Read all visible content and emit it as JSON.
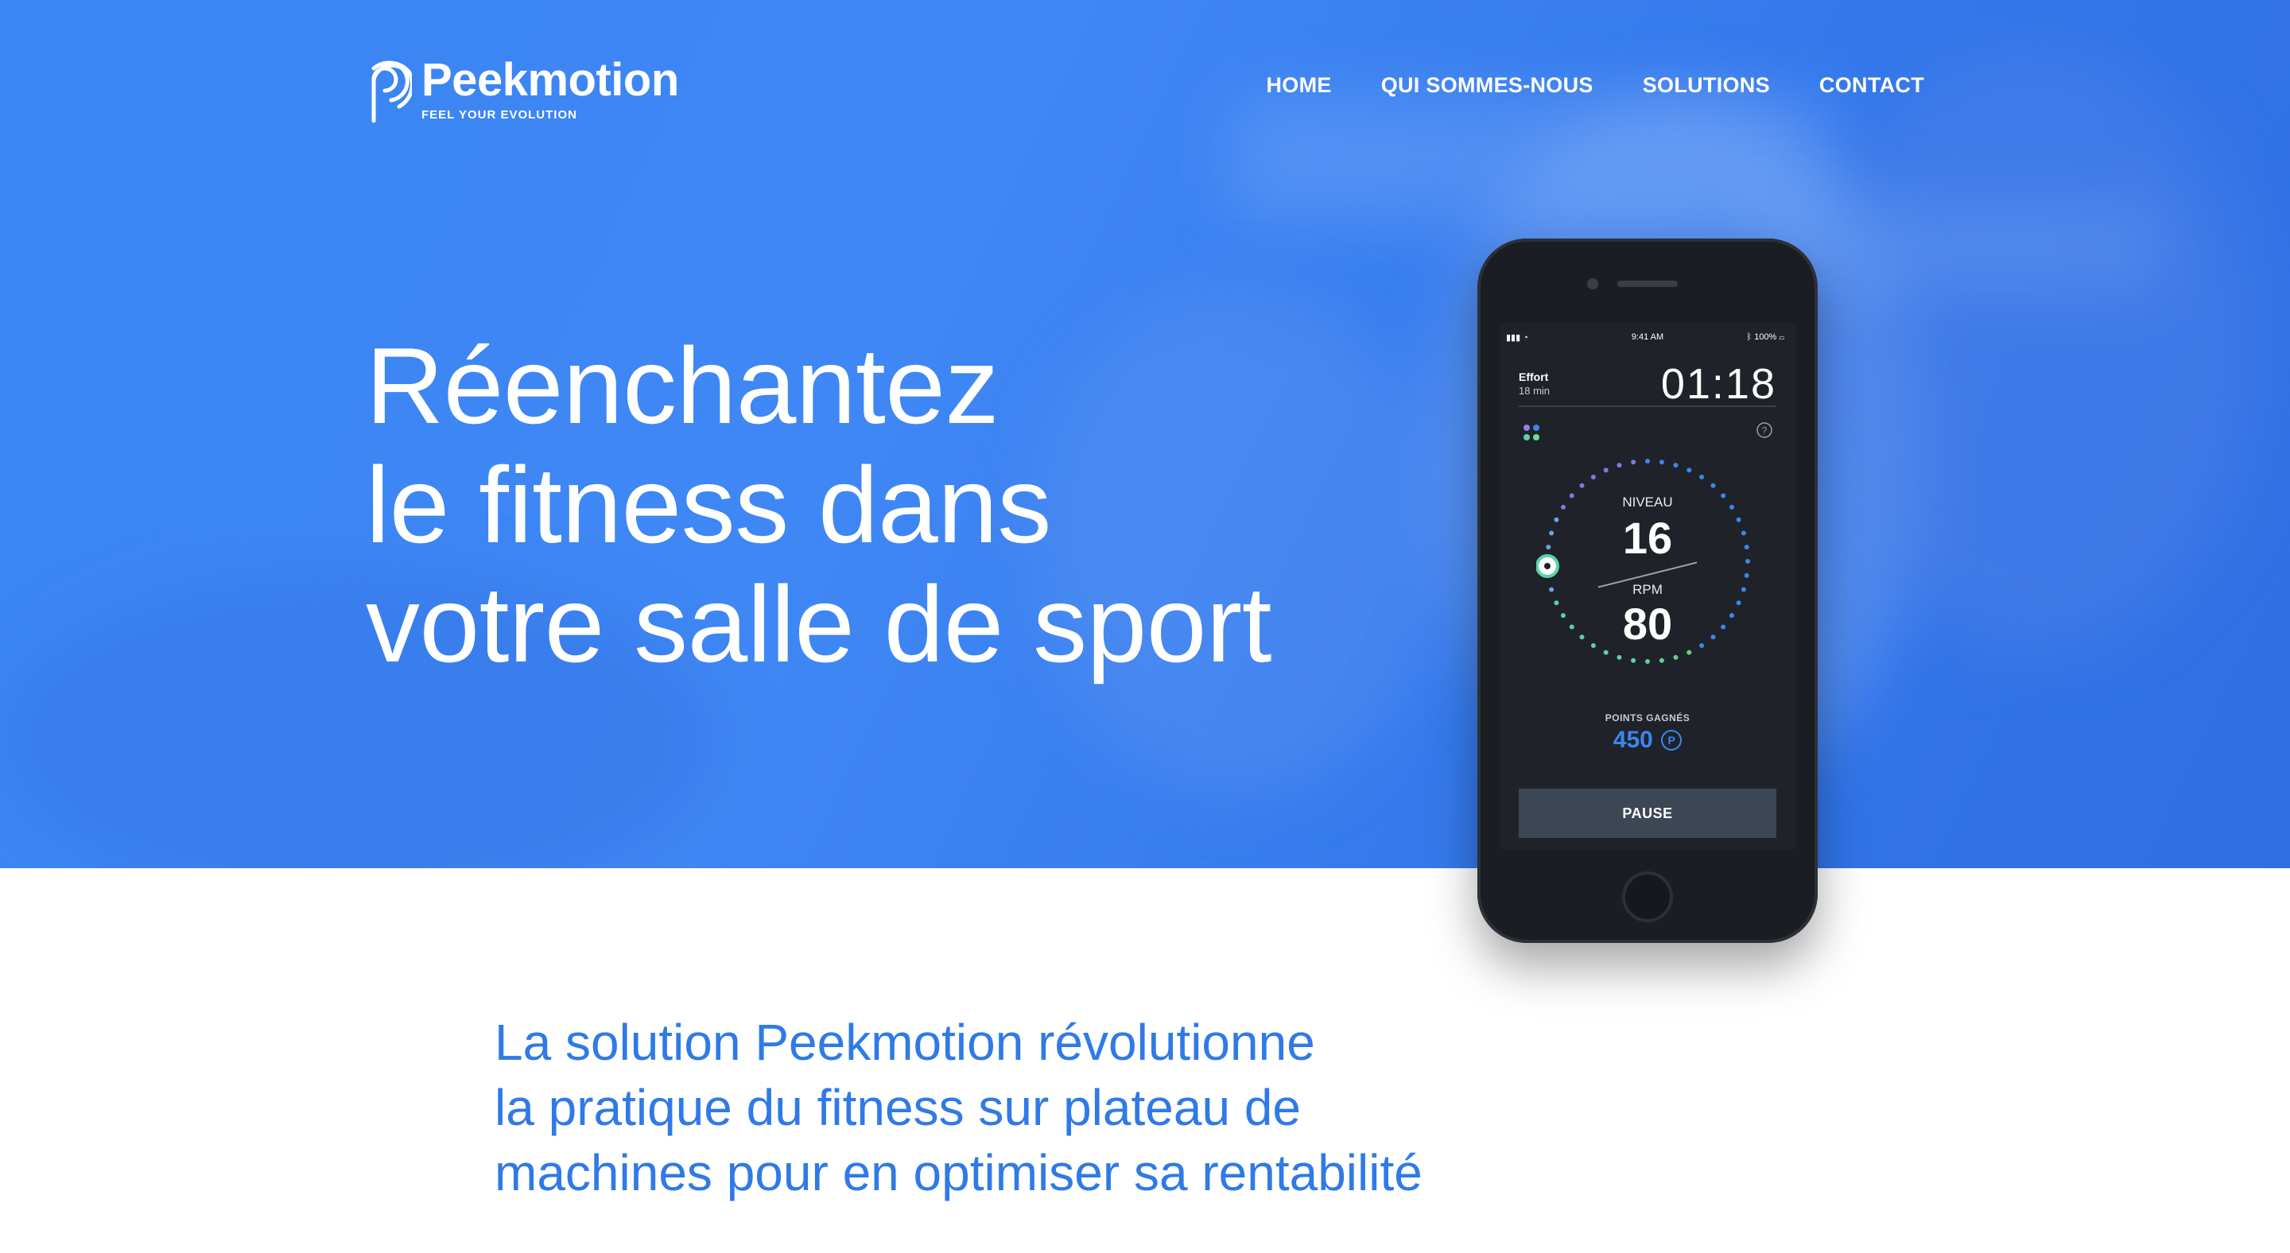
{
  "colors": {
    "hero_blue": "#3a86f3",
    "accent_blue": "#2f7ae6",
    "phone_body": "#1a1d22",
    "screen_bg": "#1f2329",
    "pause_button": "#3d4654"
  },
  "brand": {
    "name": "Peekmotion",
    "tagline": "FEEL YOUR EVOLUTION",
    "logo_icon": "peekmotion-logo-icon"
  },
  "nav": {
    "items": [
      {
        "label": "HOME"
      },
      {
        "label": "QUI SOMMES-NOUS"
      },
      {
        "label": "SOLUTIONS"
      },
      {
        "label": "CONTACT"
      }
    ]
  },
  "hero": {
    "headline_lines": [
      "Réenchantez",
      "le fitness dans",
      "votre salle de sport"
    ]
  },
  "phone": {
    "status": {
      "time": "9:41 AM",
      "battery": "100%",
      "signal_icon": "signal-wifi-icon",
      "bluetooth_icon": "bluetooth-icon"
    },
    "effort_label": "Effort",
    "effort_duration": "18 min",
    "timer": "01:18",
    "level_label": "NIVEAU",
    "level_value": "16",
    "rpm_label": "RPM",
    "rpm_value": "80",
    "points_label": "POINTS GAGNÉS",
    "points_value": "450",
    "points_unit": "P",
    "pause_label": "PAUSE",
    "menu_icon": "apps-dots-icon",
    "help_icon": "help-circle-icon"
  },
  "intro": {
    "lines": [
      "La solution Peekmotion révolutionne",
      "la pratique du fitness sur plateau de",
      "machines pour en optimiser sa rentabilité"
    ]
  }
}
